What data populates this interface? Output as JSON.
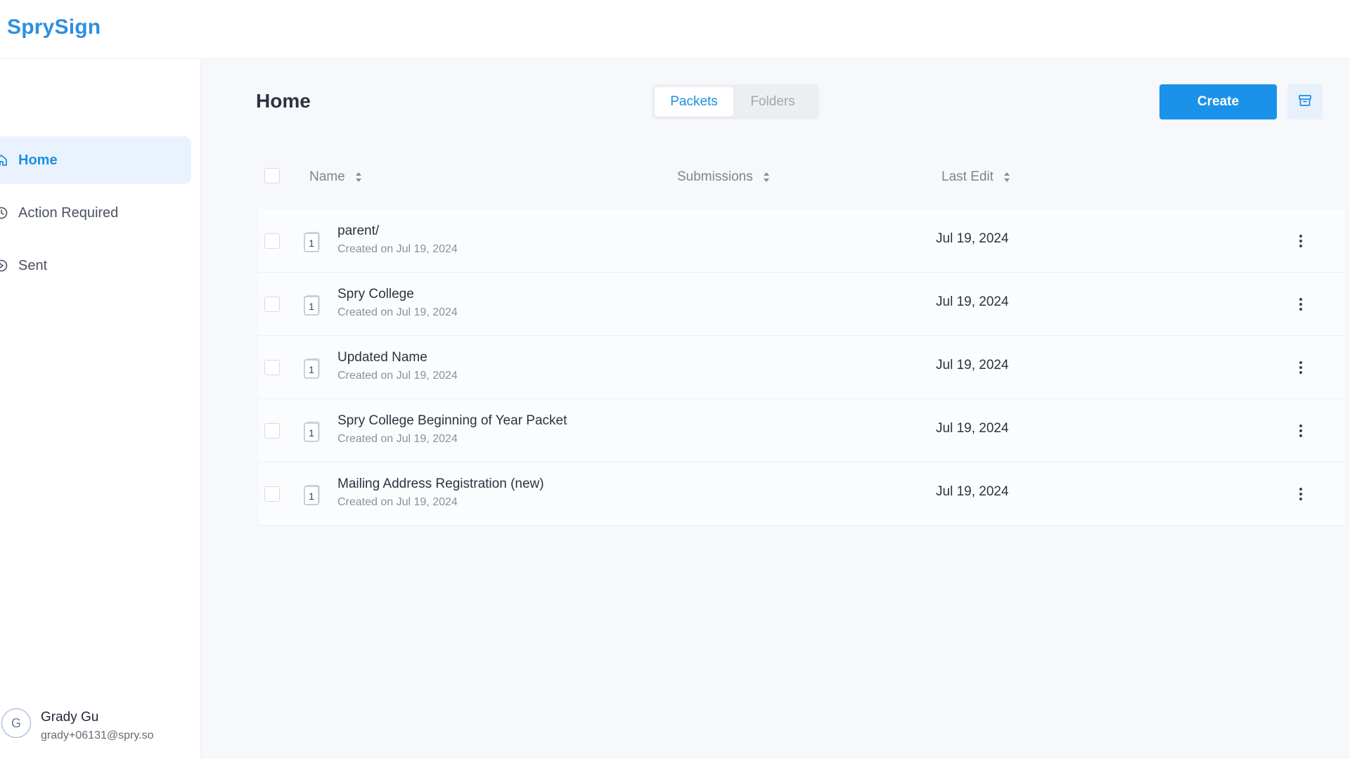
{
  "app": {
    "logo": "SprySign"
  },
  "sidebar": {
    "items": [
      {
        "label": "Home",
        "icon": "home-icon",
        "active": true
      },
      {
        "label": "Action Required",
        "icon": "clock-icon",
        "active": false
      },
      {
        "label": "Sent",
        "icon": "send-icon",
        "active": false
      }
    ],
    "user": {
      "initial": "G",
      "name": "Grady Gu",
      "email": "grady+06131@spry.so"
    }
  },
  "main": {
    "title": "Home",
    "tabs": [
      {
        "label": "Packets",
        "active": true
      },
      {
        "label": "Folders",
        "active": false
      }
    ],
    "create_label": "Create",
    "archive_icon": "archive-icon",
    "columns": {
      "name": "Name",
      "submissions": "Submissions",
      "last_edit": "Last Edit"
    },
    "rows": [
      {
        "name": "parent/",
        "created": "Created on Jul 19, 2024",
        "badge": "1",
        "last_edit": "Jul 19, 2024"
      },
      {
        "name": "Spry College",
        "created": "Created on Jul 19, 2024",
        "badge": "1",
        "last_edit": "Jul 19, 2024"
      },
      {
        "name": "Updated Name",
        "created": "Created on Jul 19, 2024",
        "badge": "1",
        "last_edit": "Jul 19, 2024"
      },
      {
        "name": "Spry College Beginning of Year Packet",
        "created": "Created on Jul 19, 2024",
        "badge": "1",
        "last_edit": "Jul 19, 2024"
      },
      {
        "name": "Mailing Address Registration (new)",
        "created": "Created on Jul 19, 2024",
        "badge": "1",
        "last_edit": "Jul 19, 2024"
      }
    ]
  },
  "colors": {
    "accent": "#1a92e9",
    "active_bg": "#eaf3fd",
    "page_bg": "#f6f8fb"
  }
}
